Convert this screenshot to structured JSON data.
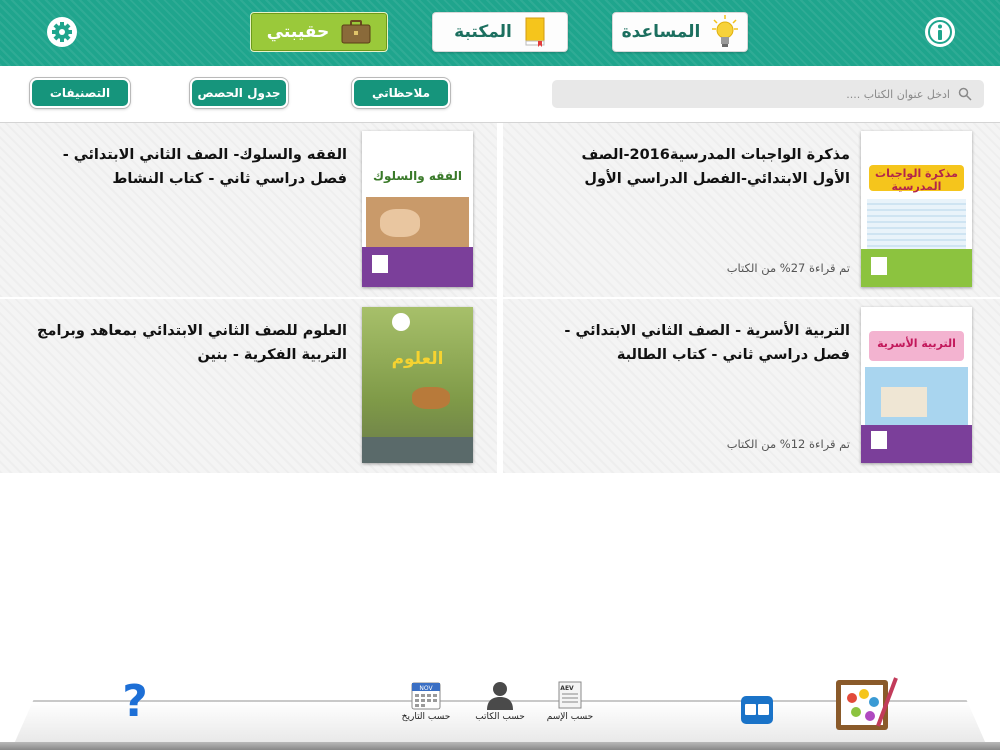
{
  "header": {
    "help_label": "المساعدة",
    "library_label": "المكتبة",
    "bag_label": "حقيبتي"
  },
  "toolbar": {
    "categories_label": "التصنيفات",
    "schedule_label": "جدول الحصص",
    "notes_label": "ملاحظاتي",
    "search_placeholder": "ادخل عنوان الكتاب ...."
  },
  "books": [
    {
      "title": "مذكرة الواجبات المدرسية2016-الصف الأول الابتدائي-الفصل الدراسي الأول",
      "progress": "تم قراءة 27% من الكتاب",
      "cover_title": "مذكرة الواجبات المدرسية",
      "cover_color": "#2c9bd4"
    },
    {
      "title": "الفقه والسلوك- الصف الثاني الابتدائي - فصل دراسي ثاني - كتاب النشاط",
      "progress": "",
      "cover_title": "الفقه والسلوك",
      "cover_color": "#8cc33f"
    },
    {
      "title": "التربية الأسرية - الصف الثاني الابتدائي - فصل دراسي ثاني - كتاب الطالبة",
      "progress": "تم قراءة 12% من الكتاب",
      "cover_title": "التربية الأسرية",
      "cover_color": "#e24a8f"
    },
    {
      "title": "العلوم للصف الثاني الابتدائي بمعاهد وبرامج التربية الفكرية - بنين",
      "progress": "",
      "cover_title": "العلوم",
      "cover_color": "#7a9a4a"
    }
  ],
  "bottom": {
    "sort_date": "حسب التاريخ",
    "sort_author": "حسب الكاتب",
    "sort_name": "حسب الإسم",
    "calendar_month": "NOV",
    "doc_tag": "AEV"
  },
  "colors": {
    "header_bg": "#1fa58d",
    "accent": "#16957c",
    "active_button": "#9ac93a"
  }
}
